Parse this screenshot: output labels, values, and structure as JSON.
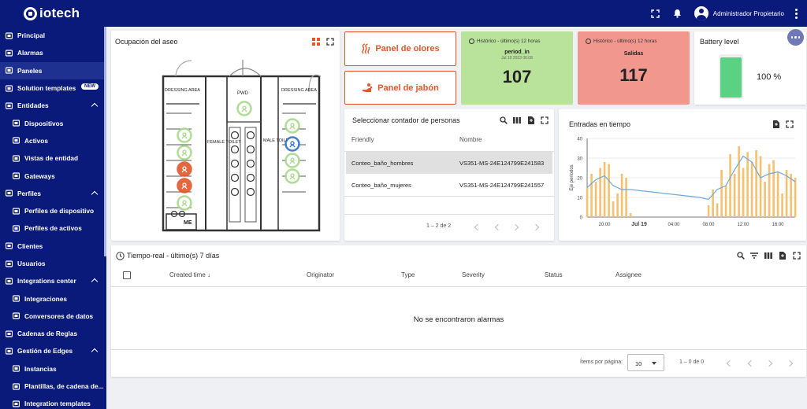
{
  "app": {
    "logo": "iotech",
    "user": "Administrador Propietario"
  },
  "sidebar": {
    "items": [
      {
        "label": "Principal",
        "icon": "home-icon",
        "sub": false,
        "active": false
      },
      {
        "label": "Alarmas",
        "icon": "warning-icon",
        "sub": false,
        "active": false
      },
      {
        "label": "Paneles",
        "icon": "dashboard-icon",
        "sub": false,
        "active": true
      },
      {
        "label": "Solution templates",
        "icon": "template-icon",
        "sub": false,
        "active": false,
        "badge": "NEW"
      },
      {
        "label": "Entidades",
        "icon": "hierarchy-icon",
        "sub": false,
        "active": false,
        "chevron": true
      },
      {
        "label": "Dispositivos",
        "icon": "device-icon",
        "sub": true,
        "active": false
      },
      {
        "label": "Activos",
        "icon": "asset-icon",
        "sub": true,
        "active": false
      },
      {
        "label": "Vistas de entidad",
        "icon": "view-icon",
        "sub": true,
        "active": false
      },
      {
        "label": "Gateways",
        "icon": "gateway-icon",
        "sub": true,
        "active": false
      },
      {
        "label": "Perfiles",
        "icon": "profiles-icon",
        "sub": false,
        "active": false,
        "chevron": true
      },
      {
        "label": "Perfiles de dispositivo",
        "icon": "device-profile-icon",
        "sub": true,
        "active": false
      },
      {
        "label": "Perfiles de activos",
        "icon": "asset-profile-icon",
        "sub": true,
        "active": false
      },
      {
        "label": "Clientes",
        "icon": "customers-icon",
        "sub": false,
        "active": false
      },
      {
        "label": "Usuarios",
        "icon": "user-icon",
        "sub": false,
        "active": false
      },
      {
        "label": "Integrations center",
        "icon": "integrations-center-icon",
        "sub": false,
        "active": false,
        "chevron": true
      },
      {
        "label": "Integraciones",
        "icon": "integration-icon",
        "sub": true,
        "active": false
      },
      {
        "label": "Conversores de datos",
        "icon": "converter-icon",
        "sub": true,
        "active": false
      },
      {
        "label": "Cadenas de Reglas",
        "icon": "rule-chain-icon",
        "sub": false,
        "active": false
      },
      {
        "label": "Gestión de Edges",
        "icon": "edge-icon",
        "sub": false,
        "active": false,
        "chevron": true
      },
      {
        "label": "Instancias",
        "icon": "instances-icon",
        "sub": true,
        "active": false
      },
      {
        "label": "Plantillas, de cadena de...",
        "icon": "rule-template-icon",
        "sub": true,
        "active": false
      },
      {
        "label": "Integration templates",
        "icon": "integration-template-icon",
        "sub": true,
        "active": false
      }
    ]
  },
  "floorplan": {
    "title": "Ocupación del aseo",
    "labels": {
      "dressing_left": "DRESSING AREA",
      "pwd": "PWD",
      "dressing_right": "DRESSING AREA",
      "female": "FEMALE TOILET",
      "male": "MALE TOILET",
      "me": "ME"
    }
  },
  "odor": {
    "label": "Panel de olores"
  },
  "soap": {
    "label": "Panel de jabón"
  },
  "period": {
    "history": "Histórico - último(s) 12 horas",
    "name": "period_in",
    "date": "Jul 19 2023 06:08",
    "value": "107"
  },
  "exits": {
    "history": "Histórico - último(s) 12 horas",
    "name": "Salidas",
    "value": "117"
  },
  "battery": {
    "title": "Battery level",
    "value": "100 %",
    "level": 1.0
  },
  "selector": {
    "title": "Seleccionar contador de personas",
    "columns": [
      "Friendly",
      "Nombre"
    ],
    "rows": [
      {
        "friendly": "Conteo_baño_hombres",
        "name": "VS351-MS-24E124799E241583"
      },
      {
        "friendly": "Conteo_baño_mujeres",
        "name": "VS351-MS-24E124799E241557"
      }
    ],
    "pagination": "1 – 2 de 2"
  },
  "chart_data": {
    "type": "bar",
    "title": "Entradas en tiempo",
    "ylabel": "Eje periodos",
    "ylim": [
      0,
      40
    ],
    "yticks": [
      0,
      10,
      20,
      30,
      40
    ],
    "xticks": [
      "20:00",
      "Jul 19",
      "04:00",
      "08:00",
      "12:00",
      "16:00"
    ],
    "x": [
      0,
      0.5,
      1,
      1.5,
      2,
      2.5,
      3,
      3.5,
      4,
      4.5,
      5,
      14,
      14.5,
      15,
      15.5,
      16,
      16.5,
      17,
      17.5,
      18,
      18.5,
      19,
      19.5,
      20,
      20.5,
      21,
      21.5,
      22,
      22.5,
      23,
      23.5,
      24
    ],
    "values": [
      15,
      22,
      18,
      25,
      28,
      27,
      8,
      12,
      22,
      20,
      2,
      6,
      14,
      7,
      24,
      16,
      32,
      22,
      36,
      25,
      33,
      28,
      34,
      31,
      18,
      27,
      29,
      23,
      12,
      24,
      22,
      20
    ],
    "line": {
      "x": [
        0,
        1,
        2,
        3,
        4,
        5,
        13,
        14,
        15,
        16,
        17,
        18,
        19,
        20,
        21,
        22,
        23,
        24
      ],
      "values": [
        15,
        19,
        21,
        16,
        14,
        14,
        10,
        9,
        14,
        16,
        24,
        31,
        28,
        20,
        22,
        23,
        21,
        18
      ]
    }
  },
  "alarms": {
    "title": "Tiempo-real - último(s) 7 días",
    "columns": [
      "Created time",
      "Originator",
      "Type",
      "Severity",
      "Status",
      "Assignee"
    ],
    "empty": "No se encontraron alarmas",
    "items_per_page_label": "Ítems por página:",
    "items_per_page": "10",
    "range": "1 – 0 de 0"
  }
}
